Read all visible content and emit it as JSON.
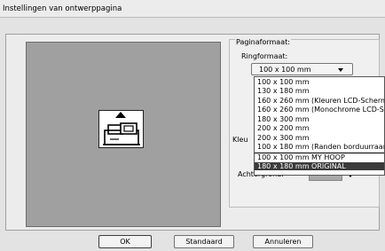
{
  "window": {
    "title": "Instellingen van ontwerppagina"
  },
  "page_size": {
    "label": "Paginaformaat:",
    "hoop_label": "Ringformaat:",
    "selected": "100 x 100 mm",
    "options": [
      "100 x 100 mm",
      "130 x 180 mm",
      "160 x 260 mm (Kleuren LCD-Scherm)",
      "160 x 260 mm (Monochrome LCD-Sche",
      "180 x 300 mm",
      "200 x 200 mm",
      "200 x 300 mm",
      "100 x 180 mm (Randen borduurraam)",
      "100 x 100 mm MY HOOP",
      "180 x 180 mm ORIGINAL"
    ],
    "highlighted_option": "180 x 180 mm ORIGINAL"
  },
  "colors": {
    "label": "Kleu",
    "background_label": "Achtergrond:",
    "background_color": "#a9a9a9"
  },
  "buttons": {
    "ok": "OK",
    "default": "Standaard",
    "cancel": "Annuleren"
  },
  "icons": {
    "hoop": "embroidery-machine-icon",
    "orientation": "up-arrow-icon"
  }
}
